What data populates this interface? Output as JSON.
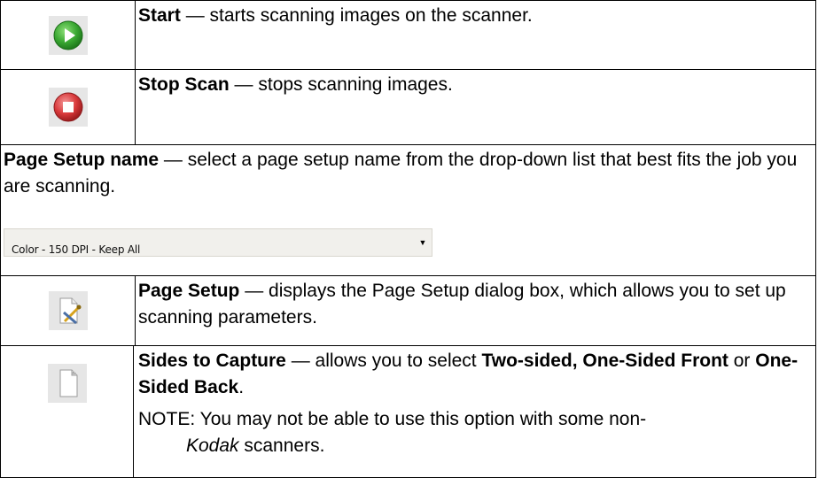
{
  "rows": [
    {
      "name": "Start",
      "sep": " — ",
      "desc": "starts scanning images on the scanner.",
      "icon": "play-icon",
      "icon_color": "#3aa832"
    },
    {
      "name": "Stop Scan",
      "sep": " — ",
      "desc": "stops scanning images.",
      "icon": "stop-icon",
      "icon_color": "#d9393b"
    },
    {
      "name": "Page Setup name",
      "sep": " — ",
      "desc": "select a page setup name from the drop-down list that best fits the job you are scanning.",
      "dropdown_value": "Color - 150 DPI - Keep All"
    },
    {
      "name": "Page Setup",
      "sep": " — ",
      "desc": "displays the Page Setup dialog box, which allows you to set up scanning parameters.",
      "icon": "page-setup-icon"
    },
    {
      "name": "Sides to Capture",
      "sep": " — ",
      "desc_before": "allows you to select ",
      "opt1": "Two-sided, One-Sided Front",
      "or": " or ",
      "opt2": "One-Sided Back",
      "period": ".",
      "note_prefix": "NOTE: You may not be able to use this option with some non-",
      "note_brand": "Kodak",
      "note_suffix": " scanners.",
      "icon": "blank-page-icon"
    }
  ]
}
